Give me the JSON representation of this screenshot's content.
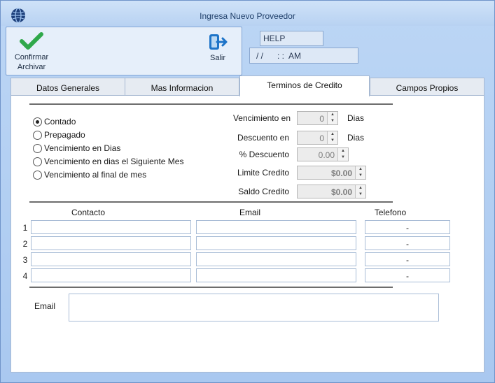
{
  "window": {
    "title": "Ingresa Nuevo Proveedor"
  },
  "toolbar": {
    "confirm_label": "Confirmar\nArchivar",
    "exit_label": "Salir"
  },
  "header": {
    "help": "HELP",
    "datetime": "/ /      : :  AM"
  },
  "tabs": [
    {
      "label": "Datos Generales",
      "active": false
    },
    {
      "label": "Mas Informacion",
      "active": false
    },
    {
      "label": "Terminos de Credito",
      "active": true
    },
    {
      "label": "Campos Propios",
      "active": false
    }
  ],
  "payment_options": [
    {
      "label": "Contado",
      "checked": true
    },
    {
      "label": "Prepagado",
      "checked": false
    },
    {
      "label": "Vencimiento en Dias",
      "checked": false
    },
    {
      "label": "Vencimiento en dias el Siguiente Mes",
      "checked": false
    },
    {
      "label": "Vencimiento al final de mes",
      "checked": false
    }
  ],
  "credit_fields": [
    {
      "label": "Vencimiento en",
      "value": "0",
      "unit": "Dias"
    },
    {
      "label": "Descuento en",
      "value": "0",
      "unit": "Dias"
    },
    {
      "label": "% Descuento",
      "value": "0.00",
      "unit": ""
    },
    {
      "label": "Limite Credito",
      "value": "$0.00",
      "unit": ""
    },
    {
      "label": "Saldo Credito",
      "value": "$0.00",
      "unit": ""
    }
  ],
  "contacts": {
    "headers": {
      "contact": "Contacto",
      "email": "Email",
      "phone": "Telefono"
    },
    "rows": [
      {
        "num": "1",
        "contact": "",
        "email": "",
        "phone": "-"
      },
      {
        "num": "2",
        "contact": "",
        "email": "",
        "phone": "-"
      },
      {
        "num": "3",
        "contact": "",
        "email": "",
        "phone": "-"
      },
      {
        "num": "4",
        "contact": "",
        "email": "",
        "phone": "-"
      }
    ]
  },
  "email_section": {
    "label": "Email",
    "value": ""
  }
}
